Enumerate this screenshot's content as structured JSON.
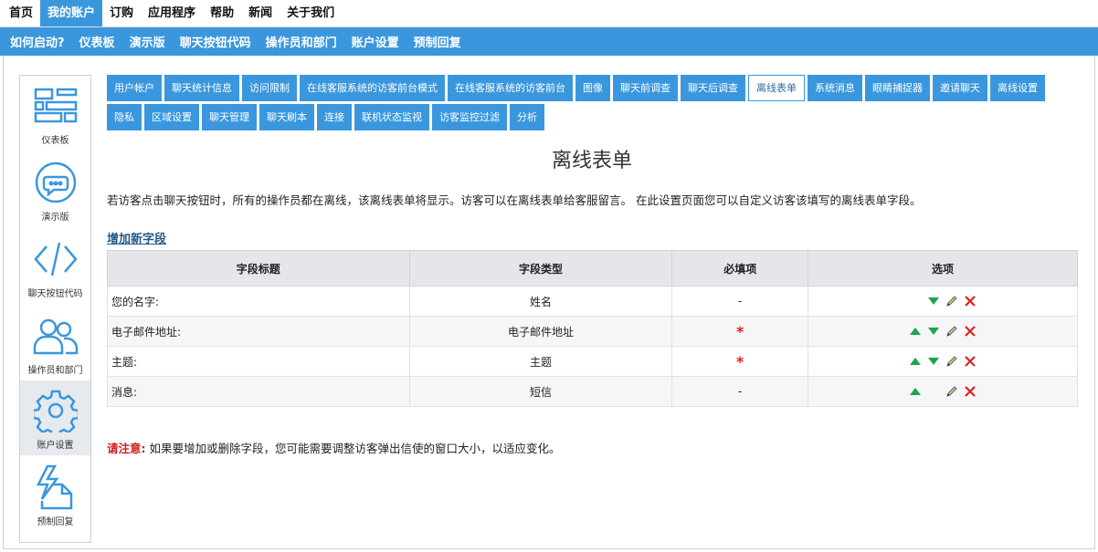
{
  "top_nav": [
    {
      "label": "首页",
      "active": false
    },
    {
      "label": "我的账户",
      "active": true
    },
    {
      "label": "订购",
      "active": false
    },
    {
      "label": "应用程序",
      "active": false
    },
    {
      "label": "帮助",
      "active": false
    },
    {
      "label": "新闻",
      "active": false
    },
    {
      "label": "关于我们",
      "active": false
    }
  ],
  "sub_nav": [
    "如何启动?",
    "仪表板",
    "演示版",
    "聊天按钮代码",
    "操作员和部门",
    "账户设置",
    "预制回复"
  ],
  "sidebar": [
    {
      "label": "仪表板",
      "icon": "dashboard-icon",
      "active": false
    },
    {
      "label": "演示版",
      "icon": "chat-bubble-icon",
      "active": false
    },
    {
      "label": "聊天按钮代码",
      "icon": "code-icon",
      "active": false
    },
    {
      "label": "操作员和部门",
      "icon": "users-icon",
      "active": false
    },
    {
      "label": "账户设置",
      "icon": "gear-icon",
      "active": true
    },
    {
      "label": "预制回复",
      "icon": "lightning-doc-icon",
      "active": false
    }
  ],
  "tabs_row1": [
    "用户帐户",
    "聊天统计信息",
    "访问限制",
    "在线客服系统的访客前台模式",
    "在线客服系统的访客前台",
    "图像",
    "聊天前调查",
    "聊天后调查",
    "离线表单",
    "系统消息",
    "眼睛捕捉器",
    "邀请聊天",
    "离线设置"
  ],
  "tabs_row2": [
    "隐私",
    "区域设置",
    "聊天管理",
    "聊天刷本",
    "连接",
    "联机状态监视",
    "访客监控过滤",
    "分析"
  ],
  "active_tab": "离线表单",
  "page": {
    "title": "离线表单",
    "intro": "若访客点击聊天按钮时，所有的操作员都在离线，该离线表单将显示。访客可以在离线表单给客服留言。 在此设置页面您可以自定义访客该填写的离线表单字段。",
    "add_field": "增加新字段"
  },
  "table": {
    "headers": [
      "字段标题",
      "字段类型",
      "必填项",
      "选项"
    ],
    "rows": [
      {
        "title": "您的名字:",
        "type": "姓名",
        "required": "-",
        "up": false,
        "down": true
      },
      {
        "title": "电子邮件地址:",
        "type": "电子邮件地址",
        "required": "*",
        "up": true,
        "down": true
      },
      {
        "title": "主题:",
        "type": "主题",
        "required": "*",
        "up": true,
        "down": true
      },
      {
        "title": "消息:",
        "type": "短信",
        "required": "-",
        "up": true,
        "down": false
      }
    ]
  },
  "note": {
    "lead": "请注意:",
    "text": " 如果要增加或删除字段，您可能需要调整访客弹出信使的窗口大小，以适应变化。"
  },
  "colors": {
    "accent": "#3a97de",
    "green": "#1aa64b",
    "red": "#e02020"
  }
}
